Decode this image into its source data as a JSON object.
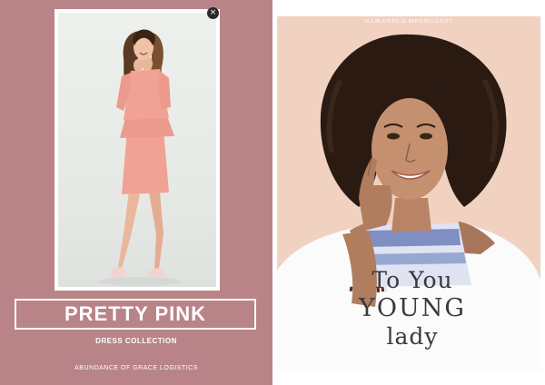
{
  "left_cover": {
    "title": "PRETTY PINK",
    "subtitle": "DRESS COLLECTION",
    "publisher": "ABUNDANCE OF GRACE LOGISTICS",
    "close_symbol": "×",
    "colors": {
      "background": "#b88487",
      "dress": "#f0a294"
    }
  },
  "right_cover": {
    "author": "NAMANDLA MPUNGANYI",
    "title_line1": "To You",
    "title_line2": "YOUNG",
    "title_line3": "lady",
    "colors": {
      "background": "#f1d2c1",
      "hair": "#2a1a12"
    }
  }
}
